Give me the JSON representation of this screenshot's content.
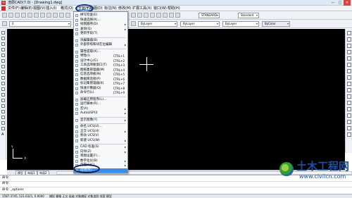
{
  "window": {
    "title": "浩辰CAD(7.0) - [Drawing1.dwg]",
    "controls": [
      "—",
      "□",
      "✕"
    ]
  },
  "menubar": {
    "items": [
      {
        "label": "文件(F)"
      },
      {
        "label": "编辑(E)"
      },
      {
        "label": "视图(V)"
      },
      {
        "label": "插入(I)"
      },
      {
        "label": "格式(O)"
      },
      {
        "label": "工具(T)",
        "active": true
      },
      {
        "label": "绘图(D)"
      },
      {
        "label": "标注(N)"
      },
      {
        "label": "修改(M)"
      },
      {
        "label": "扩展工具(X)"
      },
      {
        "label": "窗口(W)"
      },
      {
        "label": "帮助(H)"
      }
    ]
  },
  "toolbar": {
    "text_style": "STANDARD",
    "dim_style": "Standard",
    "layer_color": "ByLayer",
    "linetype": "ByLayer",
    "lineweight": "ByLayer",
    "plot_style": "ByColor",
    "layer_name": "0"
  },
  "tools_menu": {
    "items": [
      {
        "label": "拼写检查(E)",
        "sep_after": false
      },
      {
        "label": "快速选择(K)...",
        "sep_after": false
      },
      {
        "label": "绘图顺序(D)",
        "submenu": true,
        "sep_after": false
      },
      {
        "label": "查询(Q)",
        "submenu": true,
        "sep_after": false
      },
      {
        "label": "更新字段(T)",
        "sep_after": true
      },
      {
        "label": "块编辑器(B)",
        "sep_after": false
      },
      {
        "label": "外部参照和块在位编辑",
        "submenu": true,
        "sep_after": true
      },
      {
        "label": "属性提取(X)...",
        "sep_after": false
      },
      {
        "label": "特性(I)",
        "shortcut": "CTRL+1",
        "sep_after": false
      },
      {
        "label": "设计中心(G)",
        "shortcut": "CTRL+2",
        "sep_after": false
      },
      {
        "label": "工具选项板窗口(T)",
        "shortcut": "CTRL+3",
        "sep_after": false
      },
      {
        "label": "图纸集管理器(M)",
        "shortcut": "CTRL+4",
        "sep_after": false
      },
      {
        "label": "信息选项板(N)",
        "shortcut": "CTRL+5",
        "sep_after": false
      },
      {
        "label": "数据库连接(P)",
        "shortcut": "CTRL+6",
        "sep_after": false
      },
      {
        "label": "标记集管理器(K)",
        "shortcut": "CTRL+7",
        "sep_after": false
      },
      {
        "label": "快速计算器(Q)",
        "shortcut": "CTRL+8",
        "sep_after": false
      },
      {
        "label": "命令行(L)",
        "shortcut": "CTRL+9",
        "sep_after": true
      },
      {
        "label": "加载应用程序(L)...",
        "sep_after": false
      },
      {
        "label": "运行脚本(R)...",
        "sep_after": false
      },
      {
        "label": "宏(A)",
        "submenu": true,
        "sep_after": false
      },
      {
        "label": "AutoLISP(I)",
        "submenu": true,
        "sep_after": true
      },
      {
        "label": "显示图像(Y)",
        "submenu": true,
        "sep_after": true
      },
      {
        "label": "命名 UCS(U)...",
        "sep_after": false
      },
      {
        "label": "正交 UCS(H)",
        "submenu": true,
        "sep_after": false
      },
      {
        "label": "移动 UCS(V)",
        "sep_after": false
      },
      {
        "label": "新建 UCS(W)",
        "submenu": true,
        "sep_after": true
      },
      {
        "label": "CAD 标准(S)",
        "submenu": true,
        "sep_after": false
      },
      {
        "label": "向导(Z)",
        "submenu": true,
        "sep_after": false
      },
      {
        "label": "草图设置(F)...",
        "sep_after": false
      },
      {
        "label": "数字化仪(B)",
        "submenu": true,
        "sep_after": false
      },
      {
        "label": "自定义(C)",
        "submenu": true,
        "sep_after": false
      },
      {
        "label": "选项(N)...",
        "highlighted": true,
        "sep_after": false
      }
    ]
  },
  "layout_tabs": [
    "模型",
    "布局1",
    "布局2"
  ],
  "command_lines": [
    "命令:",
    "命令:",
    "命令: _options"
  ],
  "status": {
    "coords": "1587.3745, 521.6321, 0.0000",
    "modes": "捕捉 栅格 正交 极轴 对象捕捉 对象追踪 线宽 模型"
  },
  "watermark": {
    "title": "土木工程网",
    "url": "www.civilcn.com"
  },
  "colors": {
    "canvas": "#000000",
    "highlight": "#3a8ee6",
    "annotation_ellipse": "#0a1a5c",
    "watermark_text": "#1f4fa0"
  }
}
